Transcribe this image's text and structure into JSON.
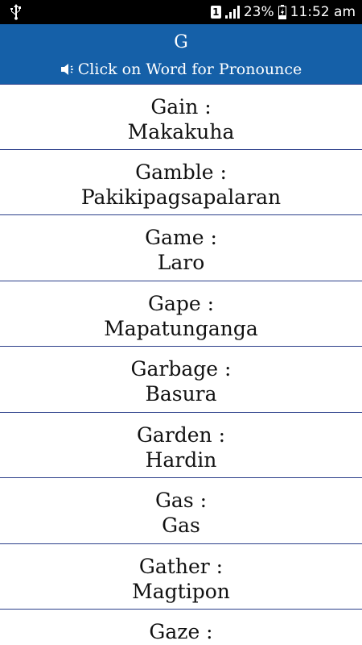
{
  "status_bar": {
    "usb_icon": "usb-icon",
    "sim": "1",
    "signal_icon": "signal-icon",
    "battery_percent": "23%",
    "battery_icon": "battery-charging-icon",
    "time": "11:52 am"
  },
  "header": {
    "letter": "G",
    "hint_icon": "speaker-icon",
    "hint": "Click on Word for Pronounce",
    "background": "#1560a8"
  },
  "words": [
    {
      "en": "Gain :",
      "tl": "Makakuha"
    },
    {
      "en": "Gamble :",
      "tl": "Pakikipagsapalaran"
    },
    {
      "en": "Game :",
      "tl": "Laro"
    },
    {
      "en": "Gape :",
      "tl": "Mapatunganga"
    },
    {
      "en": "Garbage :",
      "tl": "Basura"
    },
    {
      "en": "Garden :",
      "tl": "Hardin"
    },
    {
      "en": "Gas :",
      "tl": "Gas"
    },
    {
      "en": "Gather :",
      "tl": "Magtipon"
    },
    {
      "en": "Gaze :",
      "tl": ""
    }
  ]
}
